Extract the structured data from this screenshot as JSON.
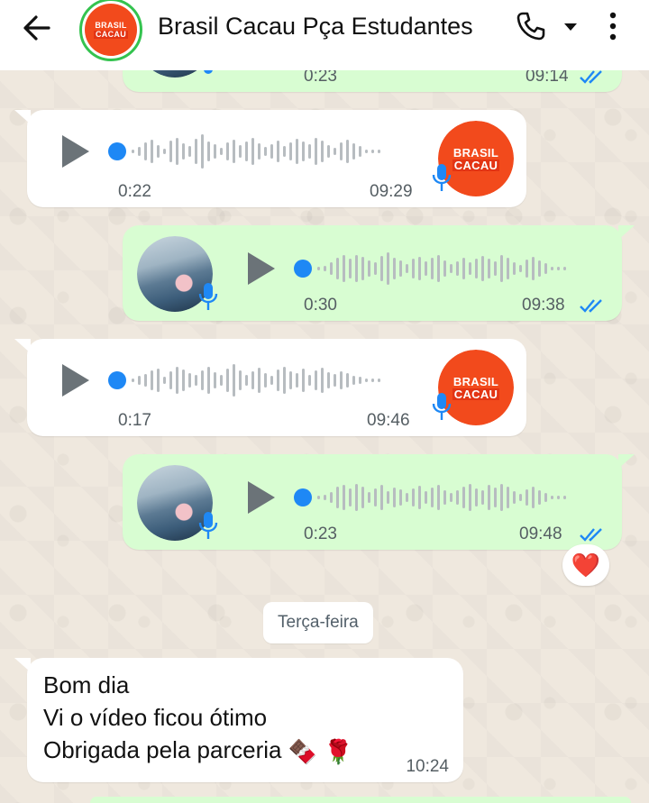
{
  "header": {
    "title": "Brasil Cacau Pça Estudantes",
    "avatar_logo": {
      "line1": "BRASIL",
      "line2": "CACAU"
    },
    "back_icon": "arrow-left-icon",
    "call_icon": "phone-icon",
    "dropdown_icon": "caret-down-icon",
    "menu_icon": "more-vertical-icon"
  },
  "contact_logo": {
    "line1": "BRASIL",
    "line2": "CACAU"
  },
  "messages": [
    {
      "direction": "out",
      "type": "voice",
      "duration": "0:23",
      "time": "09:14",
      "status": "read"
    },
    {
      "direction": "in",
      "type": "voice",
      "duration": "0:22",
      "time": "09:29"
    },
    {
      "direction": "out",
      "type": "voice",
      "duration": "0:30",
      "time": "09:38",
      "status": "read"
    },
    {
      "direction": "in",
      "type": "voice",
      "duration": "0:17",
      "time": "09:46"
    },
    {
      "direction": "out",
      "type": "voice",
      "duration": "0:23",
      "time": "09:48",
      "status": "read",
      "reaction": "❤️"
    }
  ],
  "date_separator": "Terça-feira",
  "text_message": {
    "direction": "in",
    "lines": [
      "Bom dia",
      "Vi o vídeo ficou ótimo",
      "Obrigada pela parceria"
    ],
    "emojis": [
      "🍫",
      "🌹"
    ],
    "time": "10:24"
  },
  "colors": {
    "incoming_bubble": "#ffffff",
    "outgoing_bubble": "#d8fdd2",
    "read_ticks": "#1e88f5",
    "waveform_progress_dot": "#1e88f5",
    "brand": "#f24a1c"
  }
}
